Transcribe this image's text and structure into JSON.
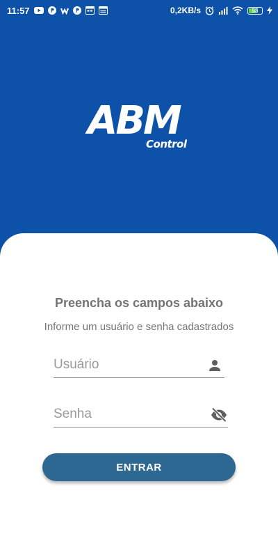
{
  "status_bar": {
    "time": "11:57",
    "left_icons": [
      "youtube-icon",
      "p-app-icon",
      "w-app-icon",
      "p-app-icon",
      "calendar-icon",
      "news-icon"
    ],
    "network_speed": "0,2KB/s",
    "battery_level": "53",
    "right_icons": [
      "alarm-icon",
      "signal-icon",
      "wifi-icon",
      "battery-icon",
      "charging-icon"
    ]
  },
  "logo": {
    "main": "ABM",
    "sub": "Control"
  },
  "login": {
    "title": "Preencha os campos abaixo",
    "subtitle": "Informe um usuário e senha cadastrados",
    "username_placeholder": "Usuário",
    "username_value": "",
    "password_placeholder": "Senha",
    "password_value": "",
    "submit_label": "ENTRAR"
  },
  "colors": {
    "header_bg": "#0d52a8",
    "button_bg": "#2c6891",
    "text_gray": "#737373"
  }
}
